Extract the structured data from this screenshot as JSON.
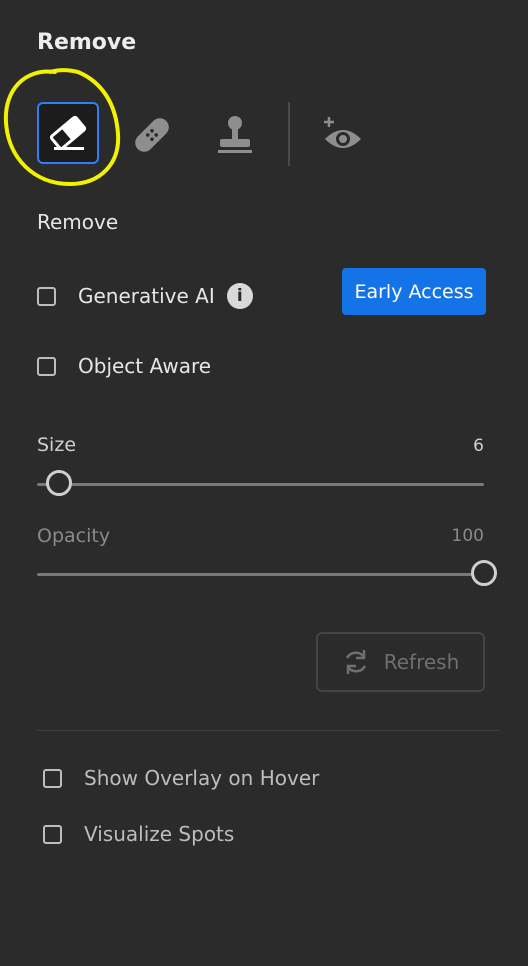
{
  "panel": {
    "title": "Remove",
    "tools": [
      {
        "name": "eraser-icon",
        "selected": true
      },
      {
        "name": "bandage-icon",
        "selected": false
      },
      {
        "name": "stamp-icon",
        "selected": false
      },
      {
        "name": "add-eye-icon",
        "selected": false
      }
    ],
    "section_label": "Remove",
    "generative_ai": {
      "label": "Generative AI",
      "checked": false,
      "info_glyph": "i"
    },
    "early_access_label": "Early Access",
    "object_aware": {
      "label": "Object Aware",
      "checked": false
    },
    "size": {
      "label": "Size",
      "value": "6",
      "level": 0.05
    },
    "opacity": {
      "label": "Opacity",
      "value": "100",
      "level": 1.0
    },
    "refresh_label": "Refresh",
    "show_overlay": {
      "label": "Show Overlay on Hover",
      "checked": false
    },
    "visualize_spots": {
      "label": "Visualize Spots",
      "checked": false
    }
  },
  "colors": {
    "accent": "#1473e6",
    "selection_border": "#2f7ef3",
    "highlight": "#f2f200",
    "background": "#2b2b2b"
  }
}
